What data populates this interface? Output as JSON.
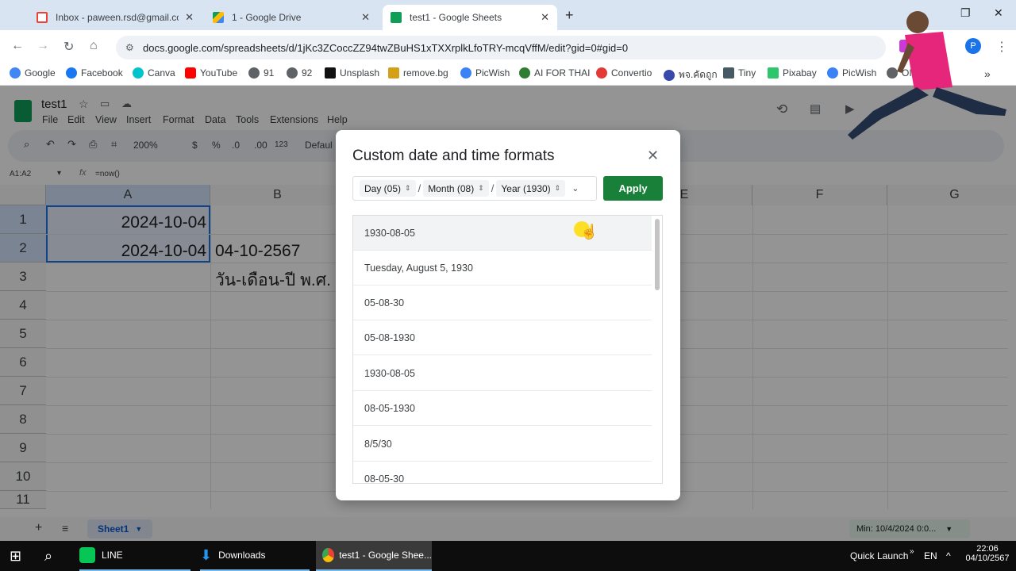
{
  "browser": {
    "tabs": [
      {
        "label": "Inbox - paween.rsd@gmail.com",
        "icon": "gmail-icon",
        "active": false
      },
      {
        "label": "1 - Google Drive",
        "icon": "drive-icon",
        "active": false
      },
      {
        "label": "test1 - Google Sheets",
        "icon": "sheets-icon",
        "active": true
      }
    ],
    "new_tab": "+",
    "url": "docs.google.com/spreadsheets/d/1jKc3ZCoccZZ94twZBuHS1xTXXrplkLfoTRY-mcqVffM/edit?gid=0#gid=0",
    "profile_initial": "P",
    "bookmarks": [
      {
        "label": "Google",
        "color": "#4285f4"
      },
      {
        "label": "Facebook",
        "color": "#1877f2"
      },
      {
        "label": "Canva",
        "color": "#00c4cc"
      },
      {
        "label": "YouTube",
        "color": "#ff0000"
      },
      {
        "label": "91",
        "color": "#5f6368"
      },
      {
        "label": "92",
        "color": "#5f6368"
      },
      {
        "label": "Unsplash",
        "color": "#111111"
      },
      {
        "label": "remove.bg",
        "color": "#d4a017"
      },
      {
        "label": "PicWish",
        "color": "#3b82f6"
      },
      {
        "label": "AI FOR THAI",
        "color": "#2e7d32"
      },
      {
        "label": "Convertio",
        "color": "#e53935"
      },
      {
        "label": "พจ.คัดถูก",
        "color": "#3949ab"
      },
      {
        "label": "Tiny",
        "color": "#455a64"
      },
      {
        "label": "Pixabay",
        "color": "#2ec66d"
      },
      {
        "label": "PicWish",
        "color": "#3b82f6"
      },
      {
        "label": "OIC",
        "color": "#5f6368"
      }
    ]
  },
  "sheets": {
    "doc_title": "test1",
    "menus": [
      "File",
      "Edit",
      "View",
      "Insert",
      "Format",
      "Data",
      "Tools",
      "Extensions",
      "Help"
    ],
    "zoom": "200%",
    "toolbar_symbols": [
      "$",
      "%",
      ".0",
      ".00",
      "123"
    ],
    "font_label": "Defaul",
    "name_box": "A1:A2",
    "formula": "=now()",
    "columns": [
      "A",
      "B",
      "E",
      "F",
      "G"
    ],
    "rows": [
      "1",
      "2",
      "3",
      "4",
      "5",
      "6",
      "7",
      "8",
      "9",
      "10",
      "11"
    ],
    "cells": {
      "A1": "2024-10-04",
      "A2": "2024-10-04",
      "B2": "04-10-2567",
      "B3": "วัน-เดือน-ปี พ.ศ."
    },
    "sheet_tab": "Sheet1",
    "summary": "Min: 10/4/2024 0:0..."
  },
  "dialog": {
    "title": "Custom date and time formats",
    "chips": [
      "Day (05)",
      "Month (08)",
      "Year (1930)"
    ],
    "separator": "/",
    "apply_label": "Apply",
    "formats": [
      "1930-08-05",
      "Tuesday, August 5, 1930",
      "05-08-30",
      "05-08-1930",
      "1930-08-05",
      "08-05-1930",
      "8/5/30",
      "08-05-30"
    ]
  },
  "taskbar": {
    "apps": [
      {
        "label": "LINE",
        "color": "#06c755"
      },
      {
        "label": "Downloads",
        "color": "#2196f3"
      },
      {
        "label": "test1 - Google Shee...",
        "color": "#ea4335"
      }
    ],
    "quick_launch": "Quick Launch",
    "lang": "EN",
    "time": "22:06",
    "date": "04/10/2567"
  },
  "colors": {
    "accent_green": "#188038",
    "sheets_green": "#0f9d58",
    "selection_blue": "#e8f0fe"
  }
}
